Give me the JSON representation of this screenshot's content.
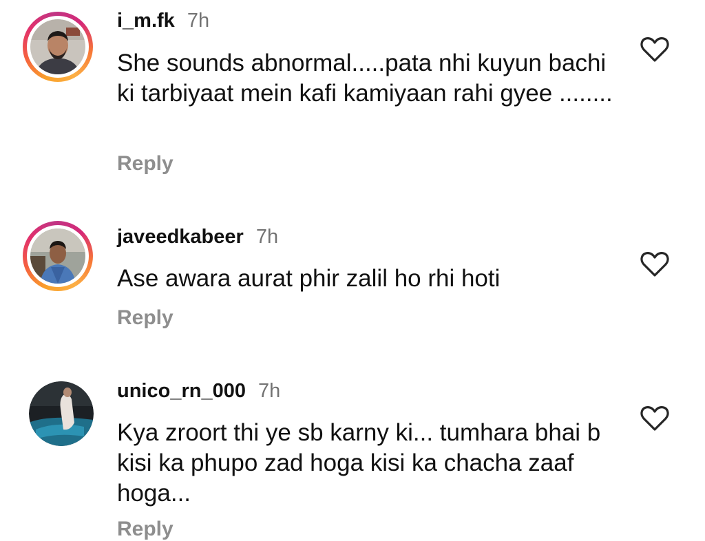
{
  "comments": [
    {
      "username": "i_m.fk",
      "time": "7h",
      "text": "She sounds abnormal.....pata nhi kuyun bachi ki tarbiyaat mein kafi kamiyaan rahi gyee ........",
      "reply_label": "Reply",
      "avatar_ring": true
    },
    {
      "username": "javeedkabeer",
      "time": "7h",
      "text": "Ase awara aurat phir zalil ho rhi hoti",
      "reply_label": "Reply",
      "avatar_ring": true
    },
    {
      "username": "unico_rn_000",
      "time": "7h",
      "text": "Kya zroort thi ye sb karny ki... tumhara bhai b kisi ka phupo zad hoga kisi ka chacha zaaf hoga...",
      "reply_label": "Reply",
      "avatar_ring": false
    }
  ],
  "icons": {
    "like": "heart-outline-icon"
  },
  "colors": {
    "username": "#111111",
    "timestamp": "#737373",
    "reply": "#8e8e8e",
    "story_ring": "#e1306c"
  }
}
